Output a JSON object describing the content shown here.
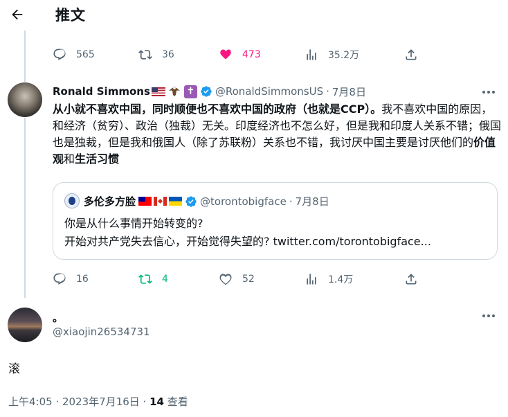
{
  "header": {
    "title": "推文"
  },
  "top_actions": {
    "replies": "565",
    "retweets": "36",
    "likes": "473",
    "views": "35.2万"
  },
  "tweet": {
    "author_name": "Ronald Simmons",
    "handle": "@RonaldSimmonsUS",
    "dot": "·",
    "date": "7月8日",
    "emoji_cross": "✝",
    "body": {
      "bold1": "从小就不喜欢中国，同时顺便也不喜欢中国的政府（也就是CCP）。",
      "text1": "我不喜欢中国的原因，和经济（贫穷）、政治（独裁）无关。印度经济也不怎么好，但是我和印度人关系不错；俄国也是独裁，但是我和俄国人（除了苏联粉）关系也不错，我讨厌中国主要是讨厌他们的",
      "bold2": "价值观",
      "text2": "和",
      "bold3": "生活习惯"
    },
    "quote": {
      "name": "多伦多方脸",
      "handle": "@torontobigface",
      "dot": "·",
      "date": "7月8日",
      "line1": "你是从什么事情开始转变的?",
      "line2": "开始对共产党失去信心，开始觉得失望的?  twitter.com/torontobigface..."
    },
    "actions": {
      "replies": "16",
      "retweets": "4",
      "likes": "52",
      "views": "1.4万"
    }
  },
  "reply": {
    "name": "。",
    "handle": "@xiaojin26534731",
    "text": "滚",
    "meta_time": "上午4:05 · 2023年7月16日 · ",
    "meta_views_count": "14",
    "meta_views_label": " 查看"
  },
  "colors": {
    "like_pink": "#f91880",
    "retweet_green": "#00ba7c",
    "verified_blue": "#1d9bf0",
    "muted": "#536471"
  }
}
